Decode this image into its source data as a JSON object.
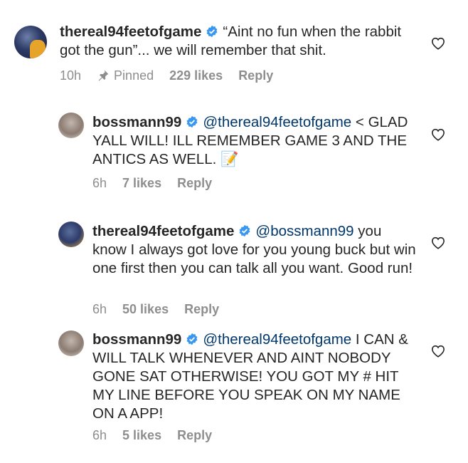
{
  "comments": [
    {
      "username": "thereal94feetofgame",
      "avatar_icon": "avatar-thereal94feetofgame",
      "mention": "",
      "body": "“Aint no fun when the rabbit got the gun”... we will remember that shit.",
      "time": "10h",
      "pinned_label": "Pinned",
      "likes": "229 likes",
      "reply_label": "Reply"
    },
    {
      "username": "bossmann99",
      "avatar_icon": "avatar-bossmann99",
      "mention": "@thereal94feetofgame",
      "body": "< GLAD YALL WILL! ILL  REMEMBER GAME 3 AND THE ANTICS AS WELL. 📝",
      "time": "6h",
      "likes": "7 likes",
      "reply_label": "Reply"
    },
    {
      "username": "thereal94feetofgame",
      "avatar_icon": "avatar-thereal94feetofgame",
      "mention": "@bossmann99",
      "body": "you know I always got love for you young buck but win one first then you can talk all you want.  Good run!",
      "time": "6h",
      "likes": "50 likes",
      "reply_label": "Reply"
    },
    {
      "username": "bossmann99",
      "avatar_icon": "avatar-bossmann99",
      "mention": "@thereal94feetofgame",
      "body": "I CAN & WILL TALK WHENEVER AND AINT NOBODY GONE SAT OTHERWISE!  YOU GOT MY # HIT MY LINE BEFORE YOU SPEAK ON MY NAME ON A APP!",
      "time": "6h",
      "likes": "5 likes",
      "reply_label": "Reply"
    }
  ],
  "colors": {
    "text": "#262626",
    "secondary": "#8e8e8e",
    "mention": "#00376b",
    "verified": "#3897f0"
  },
  "icons": [
    "verified-badge-icon",
    "pin-icon",
    "heart-outline-icon"
  ]
}
